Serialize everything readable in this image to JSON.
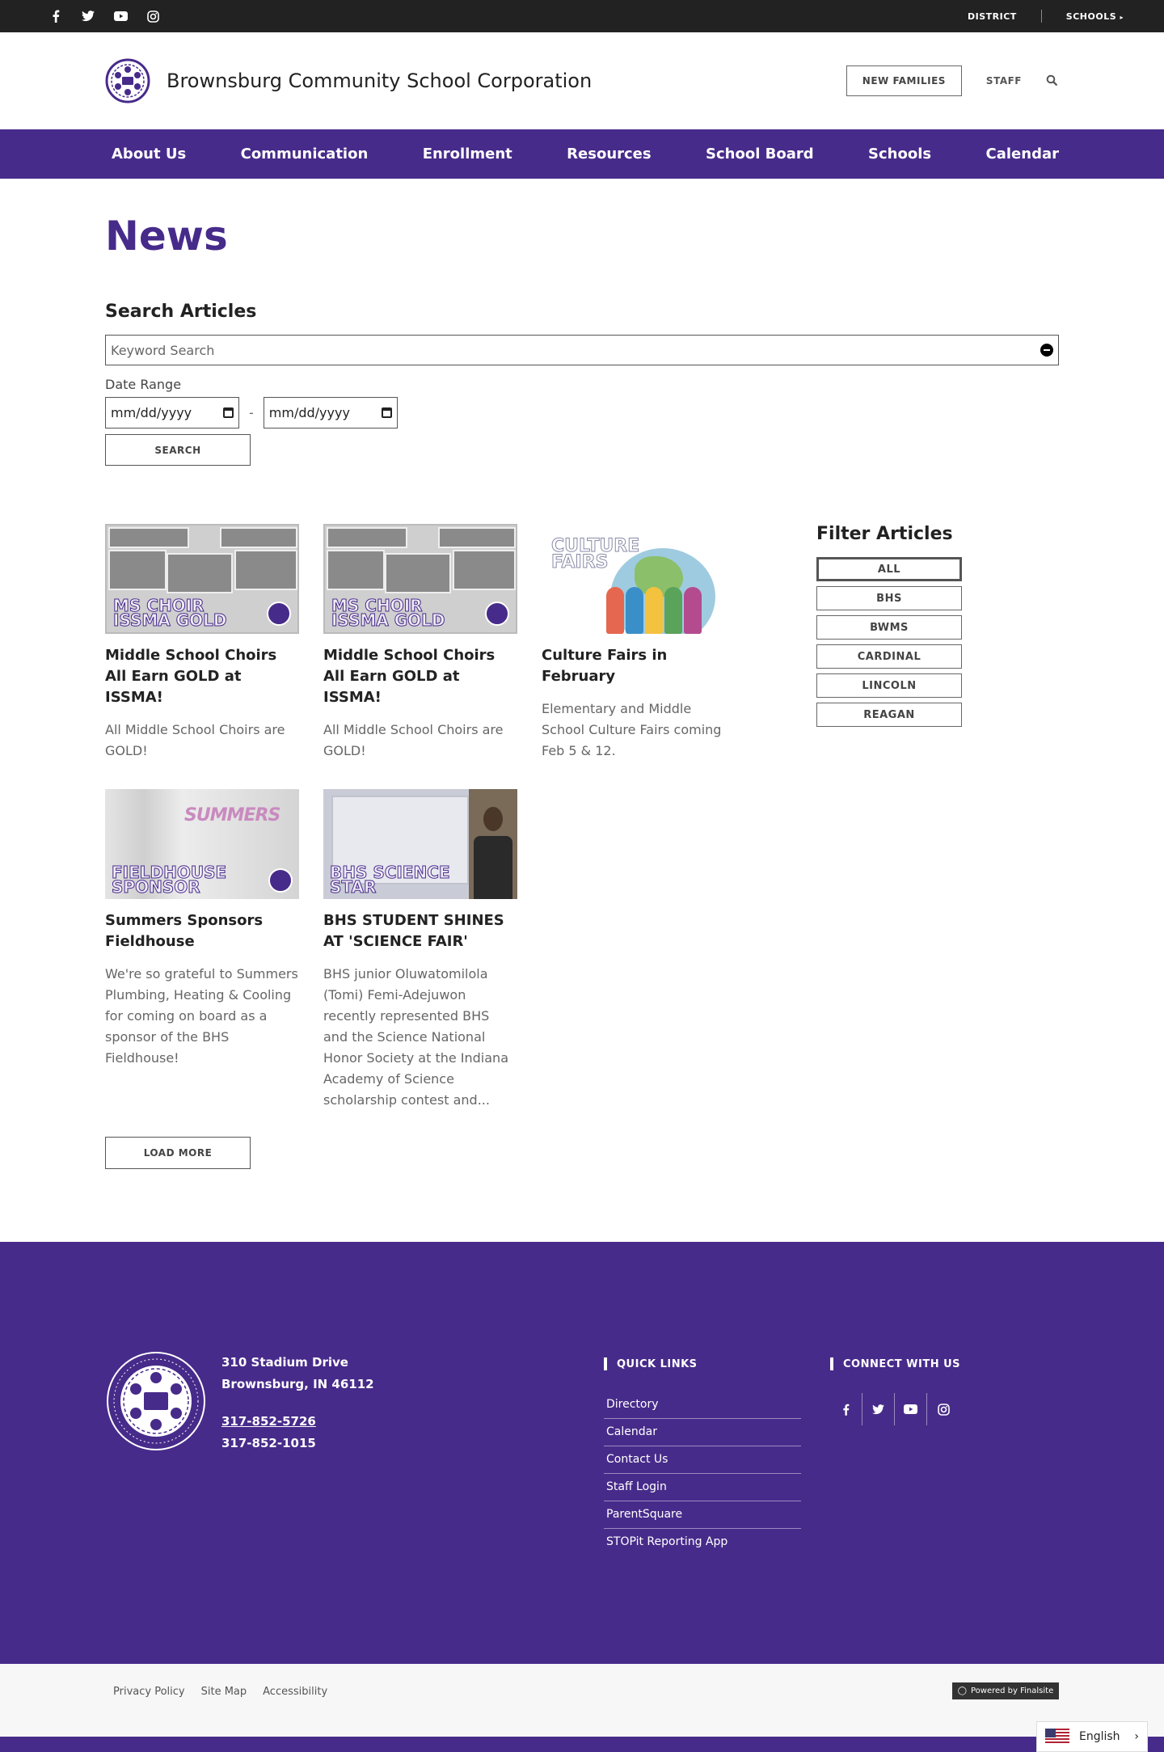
{
  "topbar": {
    "social": [
      "facebook-icon",
      "twitter-icon",
      "youtube-icon",
      "instagram-icon"
    ],
    "district": "DISTRICT",
    "schools": "SCHOOLS"
  },
  "header": {
    "title": "Brownsburg Community School Corporation",
    "new_families": "NEW FAMILIES",
    "staff": "STAFF"
  },
  "nav": [
    "About Us",
    "Communication",
    "Enrollment",
    "Resources",
    "School Board",
    "Schools",
    "Calendar"
  ],
  "page": {
    "title": "News",
    "search_heading": "Search Articles",
    "keyword_placeholder": "Keyword Search",
    "date_label": "Date Range",
    "date_from": "mm/dd/yyyy",
    "date_to": "mm/dd/yyyy",
    "date_sep": "-",
    "search_button": "SEARCH",
    "load_more": "LOAD MORE"
  },
  "articles": [
    {
      "thumb_text": "MS CHOIR ISSMA GOLD",
      "title": "Middle School Choirs All Earn GOLD at ISSMA!",
      "summary": "All Middle School Choirs are GOLD!"
    },
    {
      "thumb_text": "MS CHOIR ISSMA GOLD",
      "title": "Middle School Choirs All Earn GOLD at ISSMA!",
      "summary": "All Middle School Choirs are GOLD!"
    },
    {
      "thumb_text": "CULTURE FAIRS",
      "title": "Culture Fairs in February",
      "summary": "Elementary and Middle School Culture Fairs coming Feb 5 & 12."
    },
    {
      "thumb_text": "FIELDHOUSE SPONSOR",
      "title": "Summers Sponsors Fieldhouse",
      "summary": "We're so grateful to Summers Plumbing, Heating & Cooling for coming on board as a sponsor of the BHS Fieldhouse!"
    },
    {
      "thumb_text": "BHS SCIENCE STAR",
      "title": "BHS STUDENT SHINES AT 'SCIENCE FAIR'",
      "summary": "BHS junior Oluwatomilola (Tomi) Femi-Adejuwon recently represented BHS and the Science National Honor Society at the Indiana Academy of Science scholarship contest and..."
    }
  ],
  "filter": {
    "title": "Filter Articles",
    "options": [
      "ALL",
      "BHS",
      "BWMS",
      "CARDINAL",
      "LINCOLN",
      "REAGAN"
    ],
    "active": "ALL"
  },
  "footer": {
    "address1": "310 Stadium Drive",
    "address2": "Brownsburg, IN  46112",
    "phone": "317-852-5726",
    "fax": "317-852-1015",
    "quick_links_title": "QUICK LINKS",
    "quick_links": [
      "Directory",
      "Calendar",
      "Contact Us",
      "Staff Login",
      "ParentSquare",
      "STOPit Reporting App"
    ],
    "connect_title": "CONNECT WITH US"
  },
  "bottom": {
    "links": [
      "Privacy Policy",
      "Site Map",
      "Accessibility"
    ],
    "powered": "Powered by Finalsite",
    "language": "English"
  },
  "colors": {
    "brand": "#472b8a",
    "topbar": "#222222"
  }
}
